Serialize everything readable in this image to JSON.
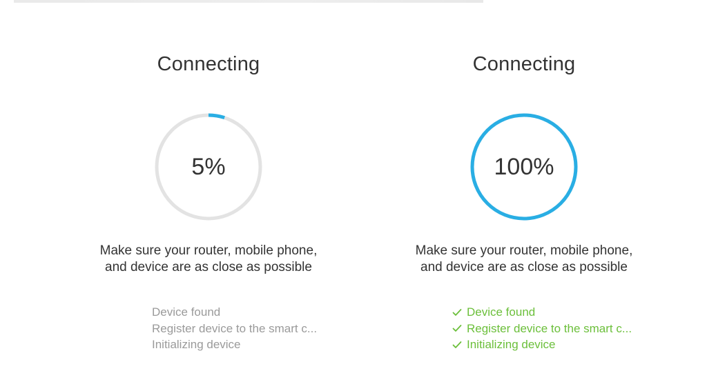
{
  "colors": {
    "accent": "#29aee4",
    "track": "#e3e3e3",
    "text": "#333333",
    "pending": "#9a9a9a",
    "done": "#6bbf3a"
  },
  "panels": [
    {
      "title": "Connecting",
      "percent_label": "5%",
      "progress": 0.05,
      "hint_line1": "Make sure your router, mobile phone,",
      "hint_line2": "and device are as close as possible",
      "steps": [
        {
          "label": "Device found",
          "status": "pending"
        },
        {
          "label": "Register device to the smart c...",
          "status": "pending"
        },
        {
          "label": "Initializing device",
          "status": "pending"
        }
      ]
    },
    {
      "title": "Connecting",
      "percent_label": "100%",
      "progress": 1.0,
      "hint_line1": "Make sure your router, mobile phone,",
      "hint_line2": "and device are as close as possible",
      "steps": [
        {
          "label": "Device found",
          "status": "done",
          "icon": "check-icon"
        },
        {
          "label": "Register device to the smart c...",
          "status": "done",
          "icon": "check-icon"
        },
        {
          "label": "Initializing device",
          "status": "done",
          "icon": "check-icon"
        }
      ]
    }
  ]
}
